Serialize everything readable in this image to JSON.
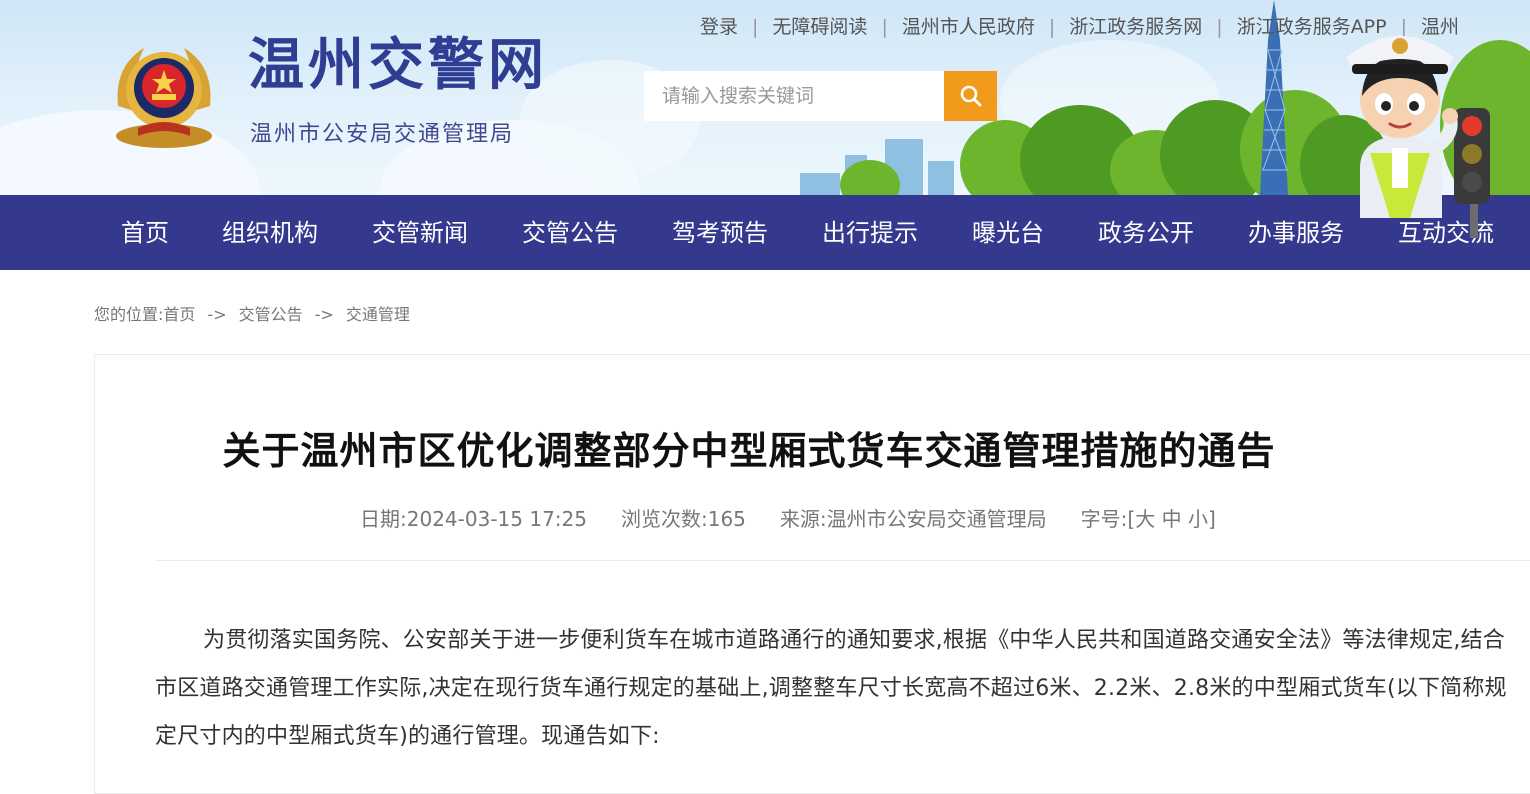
{
  "header": {
    "site_title": "温州交警网",
    "site_subtitle": "温州市公安局交通管理局",
    "top_links": [
      "登录",
      "无障碍阅读",
      "温州市人民政府",
      "浙江政务服务网",
      "浙江政务服务APP",
      "温州"
    ],
    "search": {
      "placeholder": "请输入搜索关键词",
      "button_icon": "search-icon"
    },
    "colors": {
      "title": "#2f3d92",
      "search_button": "#f29a1c"
    }
  },
  "nav": {
    "items": [
      "首页",
      "组织机构",
      "交管新闻",
      "交管公告",
      "驾考预告",
      "出行提示",
      "曝光台",
      "政务公开",
      "办事服务",
      "互动交流"
    ],
    "background": "#35398e"
  },
  "breadcrumb": {
    "prefix": "您的位置:",
    "items": [
      "首页",
      "交管公告",
      "交通管理"
    ],
    "separator": "->"
  },
  "article": {
    "title": "关于温州市区优化调整部分中型厢式货车交通管理措施的通告",
    "date_label": "日期:",
    "date": "2024-03-15 17:25",
    "views_label": "浏览次数:",
    "views": "165",
    "source_label": "来源:",
    "source": "温州市公安局交通管理局",
    "font_size_label": "字号:",
    "font_size_open": "[",
    "font_size_large": "大",
    "font_size_medium": "中",
    "font_size_small": "小",
    "font_size_close": "]",
    "paragraph": "为贯彻落实国务院、公安部关于进一步便利货车在城市道路通行的通知要求,根据《中华人民共和国道路交通安全法》等法律规定,结合市区道路交通管理工作实际,决定在现行货车通行规定的基础上,调整整车尺寸长宽高不超过6米、2.2米、2.8米的中型厢式货车(以下简称规定尺寸内的中型厢式货车)的通行管理。现通告如下:"
  }
}
